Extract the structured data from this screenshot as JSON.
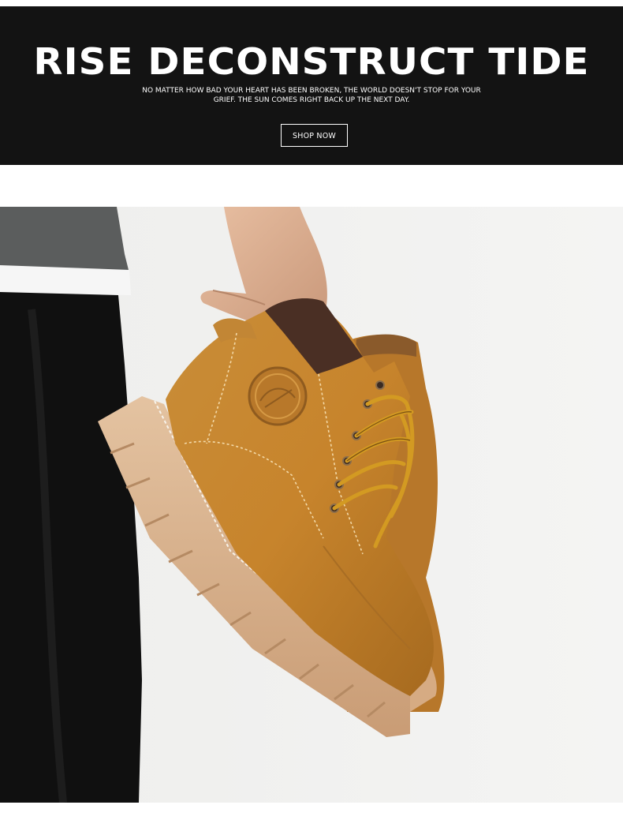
{
  "banner": {
    "title": "RISE DECONSTRUCT TIDE",
    "subtitle_line1": "NO MATTER HOW BAD YOUR HEART HAS BEEN BROKEN, THE WORLD DOESN'T STOP FOR YOUR",
    "subtitle_line2": "GRIEF. THE SUN COMES RIGHT BACK UP THE NEXT DAY.",
    "cta_label": "SHOP  NOW"
  },
  "colors": {
    "banner_background": "#131313",
    "banner_text": "#ffffff",
    "photo_background": "#f0f0ef",
    "boot_leather": "#c8862f",
    "boot_sole": "#d9b18b",
    "laces": "#d39a22"
  },
  "image": {
    "subject": "product-photo-hand-holding-tan-boot"
  }
}
